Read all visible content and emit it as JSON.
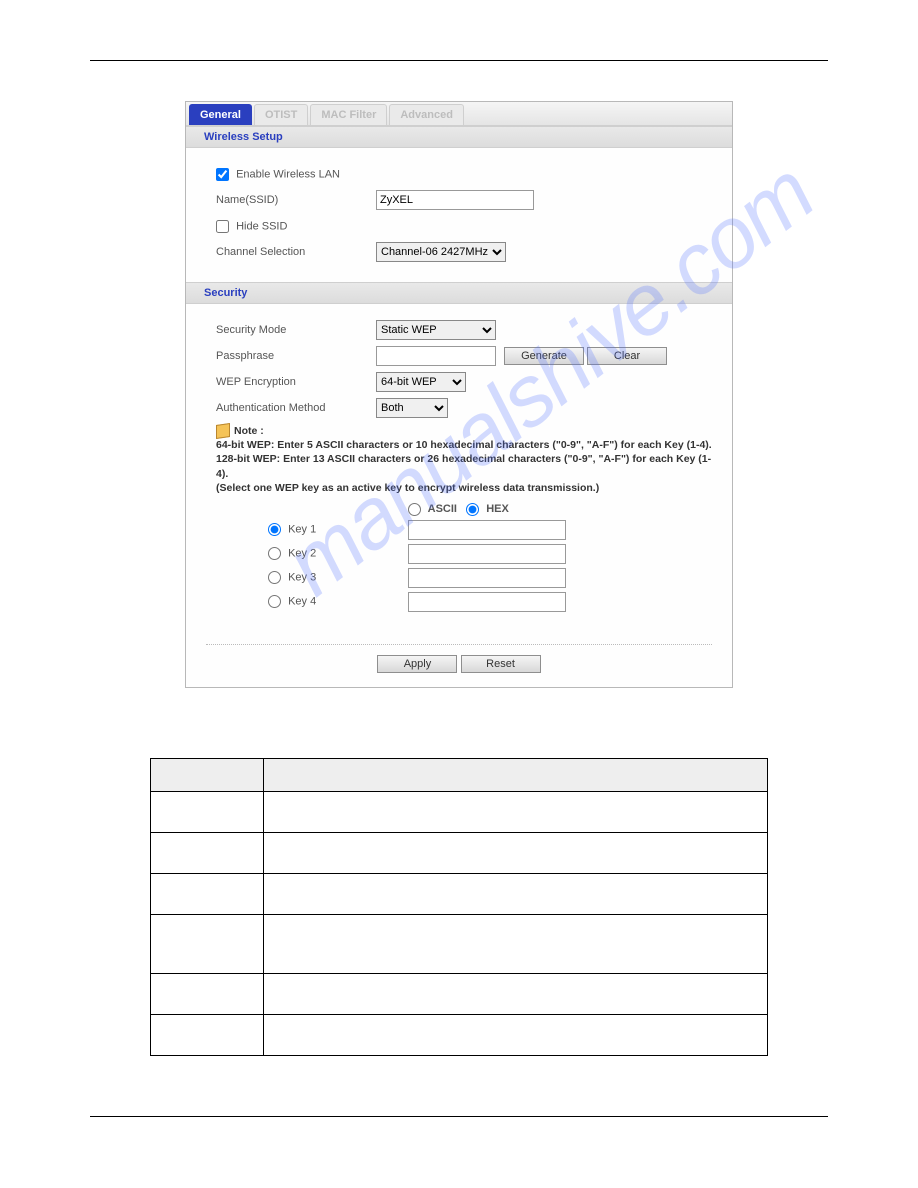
{
  "tabs": {
    "general": "General",
    "otist": "OTIST",
    "macfilter": "MAC Filter",
    "advanced": "Advanced"
  },
  "wireless": {
    "section_title": "Wireless Setup",
    "enable_label": "Enable Wireless LAN",
    "enable_checked": true,
    "ssid_label": "Name(SSID)",
    "ssid_value": "ZyXEL",
    "hide_ssid_label": "Hide SSID",
    "hide_ssid_checked": false,
    "channel_label": "Channel Selection",
    "channel_value": "Channel-06 2427MHz"
  },
  "security": {
    "section_title": "Security",
    "mode_label": "Security Mode",
    "mode_value": "Static WEP",
    "passphrase_label": "Passphrase",
    "passphrase_value": "",
    "generate_label": "Generate",
    "clear_label": "Clear",
    "wep_enc_label": "WEP Encryption",
    "wep_enc_value": "64-bit WEP",
    "auth_label": "Authentication Method",
    "auth_value": "Both",
    "note_title": "Note :",
    "note_line1": "64-bit WEP: Enter 5 ASCII characters or 10 hexadecimal characters (\"0-9\", \"A-F\") for each Key (1-4).",
    "note_line2": "128-bit WEP: Enter 13 ASCII characters or 26 hexadecimal characters (\"0-9\", \"A-F\") for each Key (1-4).",
    "note_line3": "(Select one WEP key as an active key to encrypt wireless data transmission.)",
    "enc_ascii": "ASCII",
    "enc_hex": "HEX",
    "enc_selected": "HEX",
    "keys": [
      {
        "label": "Key 1",
        "value": "",
        "selected": true
      },
      {
        "label": "Key 2",
        "value": "",
        "selected": false
      },
      {
        "label": "Key 3",
        "value": "",
        "selected": false
      },
      {
        "label": "Key 4",
        "value": "",
        "selected": false
      }
    ]
  },
  "footer": {
    "apply": "Apply",
    "reset": "Reset"
  },
  "watermark": "manualshive.com"
}
